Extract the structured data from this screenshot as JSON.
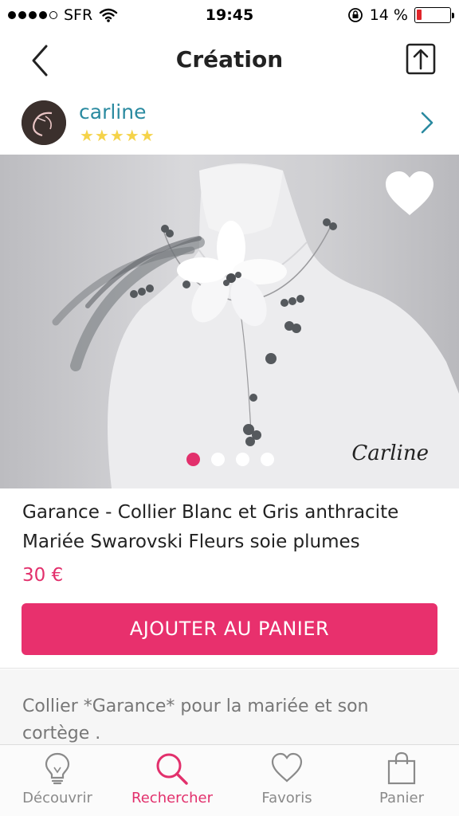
{
  "status_bar": {
    "carrier": "SFR",
    "time": "19:45",
    "battery_percent": "14 %",
    "battery_level": 0.14,
    "signal_bars": 4,
    "signal_total": 5
  },
  "nav": {
    "title": "Création",
    "back_icon": "chevron-left-icon",
    "share_icon": "share-icon"
  },
  "seller": {
    "name": "carline",
    "rating_stars": "★★★★★",
    "rating": 5
  },
  "product": {
    "image_watermark": "Carline",
    "carousel": {
      "count": 4,
      "active_index": 0
    },
    "title": "Garance - Collier Blanc et Gris anthracite Mariée Swarovski Fleurs soie plumes",
    "price": "30 €",
    "add_to_cart_label": "AJOUTER AU PANIER",
    "description": "Collier *Garance* pour la mariée et son cortège ."
  },
  "tabs": [
    {
      "label": "Découvrir",
      "icon": "lightbulb-icon",
      "active": false
    },
    {
      "label": "Rechercher",
      "icon": "search-icon",
      "active": true
    },
    {
      "label": "Favoris",
      "icon": "heart-icon",
      "active": false
    },
    {
      "label": "Panier",
      "icon": "shopping-bag-icon",
      "active": false
    }
  ],
  "colors": {
    "accent": "#e2306c",
    "seller_name": "#2a8aa0",
    "stars": "#f5d34a",
    "tab_inactive": "#8a8a8a"
  }
}
